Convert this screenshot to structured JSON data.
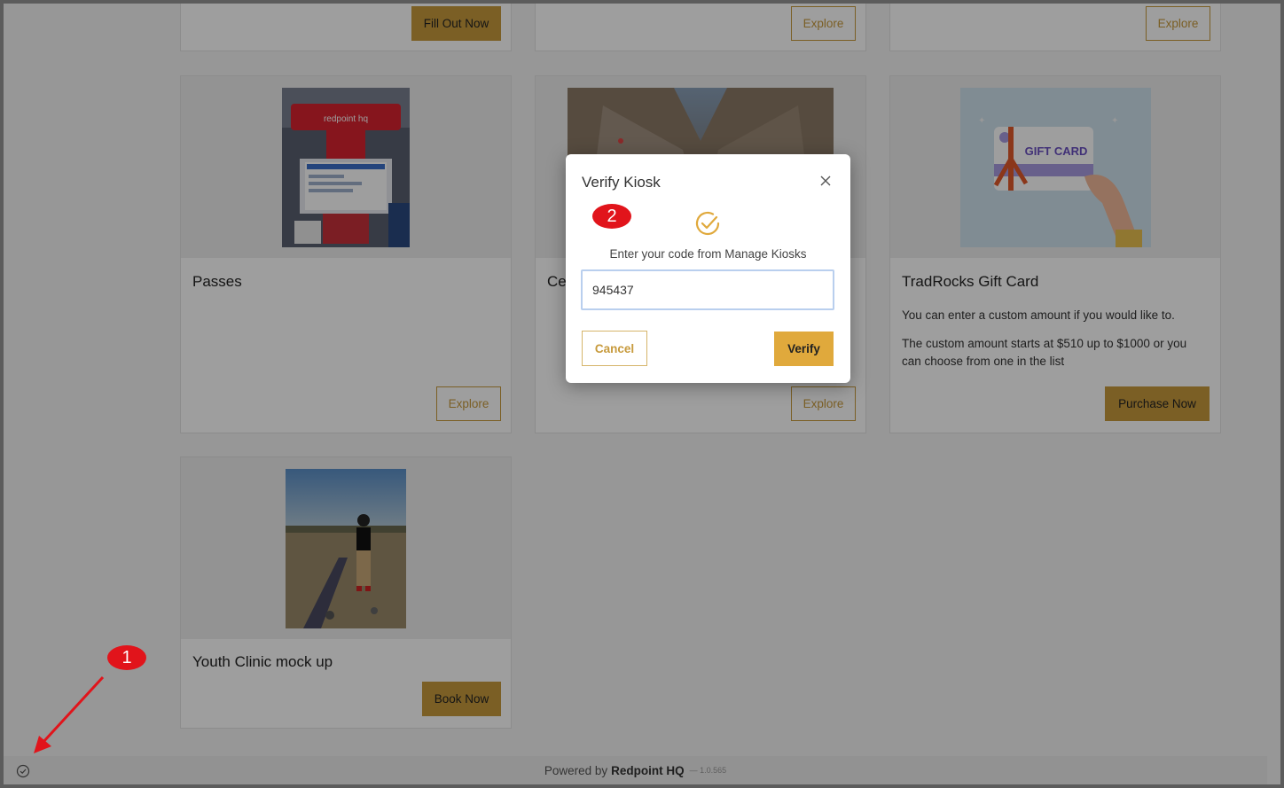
{
  "cards_top": [
    {
      "button": "Fill Out Now"
    },
    {
      "button": "Explore"
    },
    {
      "button": "Explore"
    }
  ],
  "cards": [
    {
      "title": "Passes",
      "button": "Explore",
      "kiosk_brand": "redpoint hq"
    },
    {
      "title": "Ce",
      "button": "Explore"
    },
    {
      "title": "TradRocks Gift Card",
      "desc1": "You can enter a custom amount if you would like to.",
      "desc2": "The custom amount starts at $510 up to $1000 or you can choose from one in the list",
      "button": "Purchase Now",
      "gift_text": "GIFT CARD"
    },
    {
      "title": "Youth Clinic mock up",
      "button": "Book Now"
    }
  ],
  "footer": {
    "prefix": "Powered by",
    "brand": "Redpoint HQ",
    "version": "— 1.0.565"
  },
  "modal": {
    "title": "Verify Kiosk",
    "instruction": "Enter your code from Manage Kiosks",
    "code_value": "945437",
    "cancel_label": "Cancel",
    "verify_label": "Verify"
  },
  "annotations": {
    "badge1": "1",
    "badge2": "2"
  },
  "colors": {
    "accent": "#c79a3c",
    "badge": "#e1141b",
    "verify": "#e0a93c"
  }
}
